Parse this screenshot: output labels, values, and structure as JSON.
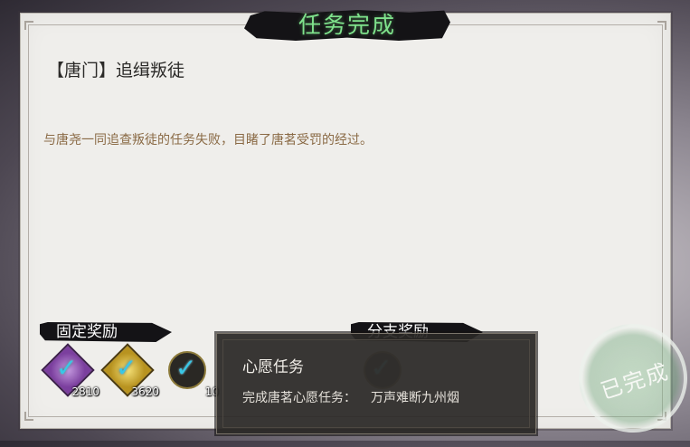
{
  "dialog": {
    "title": "任务完成",
    "quest_name": "【唐门】追缉叛徒",
    "description": "与唐尧一同追查叛徒的任务失败，目睹了唐茗受罚的经过。"
  },
  "rewards": {
    "fixed_label": "固定奖励",
    "branch_label": "分支奖励",
    "items": [
      {
        "icon": "purple-gem-icon",
        "count": "2810"
      },
      {
        "icon": "gold-coin-icon",
        "count": "3620"
      },
      {
        "icon": "character-token-icon",
        "count": "10"
      }
    ]
  },
  "tooltip": {
    "title": "心愿任务",
    "body_label": "完成唐茗心愿任务：",
    "body_value": "万声难断九州烟"
  },
  "stamp": {
    "text": "已完成"
  },
  "colors": {
    "title_green": "#7fe28c",
    "check_blue": "#39c7e6",
    "desc_brown": "#8a6a45"
  }
}
